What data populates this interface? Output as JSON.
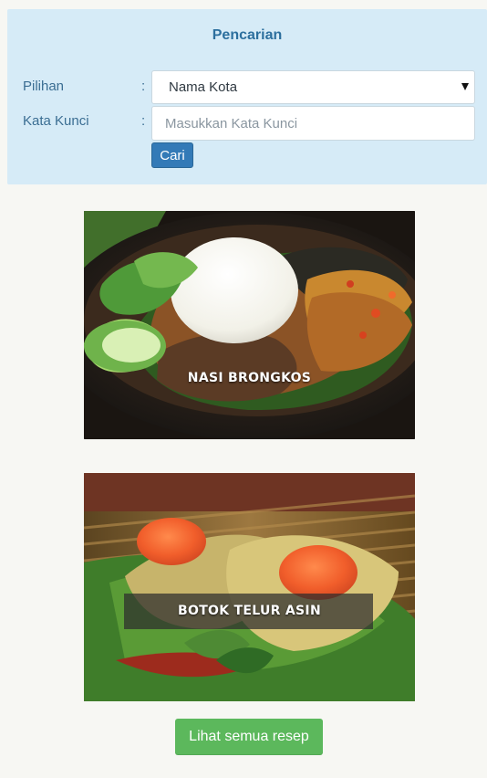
{
  "search": {
    "title": "Pencarian",
    "option_label": "Pilihan",
    "colon": ":",
    "option_value": "Nama Kota",
    "keyword_label": "Kata Kunci",
    "keyword_placeholder": "Masukkan Kata Kunci",
    "keyword_value": "",
    "search_button": "Cari"
  },
  "recipes": [
    {
      "name": "NASI BRONGKOS"
    },
    {
      "name": "BOTOK TELUR ASIN"
    }
  ],
  "actions": {
    "view_all": "Lihat semua resep"
  },
  "colors": {
    "page_background": "#f7f7f3",
    "search_panel": "#d6ebf7",
    "primary_button": "#337ab7",
    "success_button": "#5cb85c"
  }
}
